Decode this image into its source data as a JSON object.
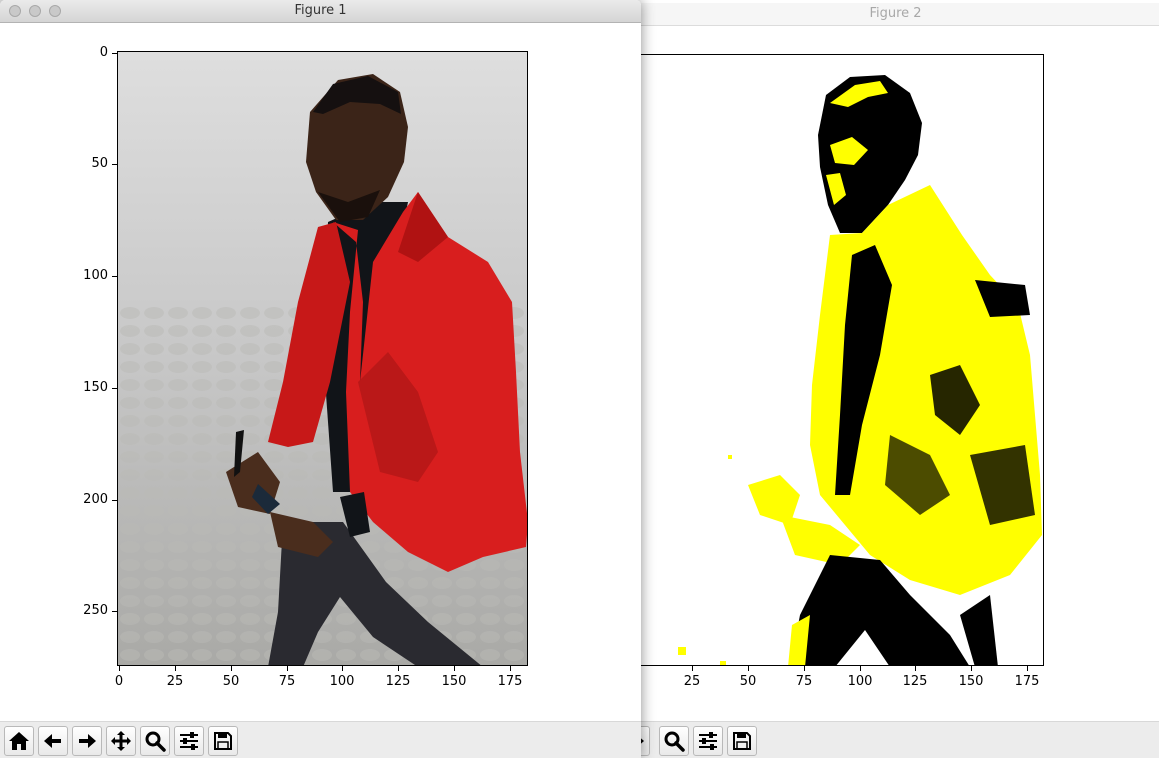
{
  "windows": {
    "figure1": {
      "title": "Figure 1"
    },
    "figure2": {
      "title": "Figure 2"
    }
  },
  "axes1": {
    "ytick_labels": [
      "0",
      "50",
      "100",
      "150",
      "200",
      "250"
    ],
    "xtick_labels": [
      "0",
      "25",
      "50",
      "75",
      "100",
      "125",
      "150",
      "175"
    ]
  },
  "axes2": {
    "xtick_labels": [
      "25",
      "50",
      "75",
      "100",
      "125",
      "150",
      "175"
    ]
  },
  "toolbar1": [
    "home-icon",
    "back-arrow-icon",
    "forward-arrow-icon",
    "pan-move-icon",
    "zoom-magnifier-icon",
    "configure-subplots-icon",
    "save-floppy-icon"
  ],
  "toolbar2": [
    "forward-arrow-icon",
    "zoom-magnifier-icon",
    "configure-subplots-icon",
    "save-floppy-icon"
  ],
  "colors": {
    "jacket": "#d81e1e",
    "binary_fg": "#ffff00",
    "binary_bg": "#000000"
  }
}
